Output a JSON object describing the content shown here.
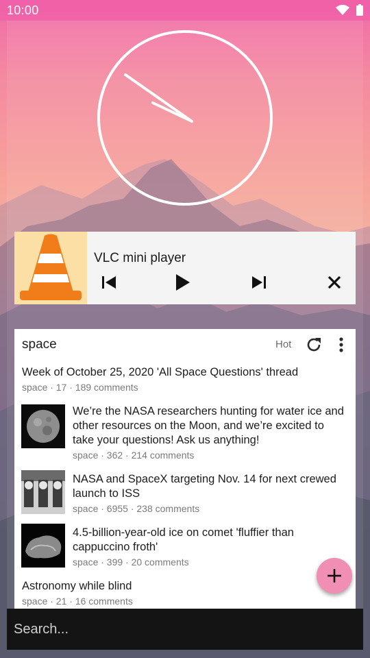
{
  "status_bar": {
    "time": "10:00",
    "icons": [
      "wifi-icon",
      "battery-icon"
    ]
  },
  "vlc_player": {
    "title": "VLC mini player",
    "controls": [
      "previous",
      "play",
      "next",
      "close"
    ]
  },
  "reddit_widget": {
    "subreddit": "space",
    "sort": "Hot",
    "posts": [
      {
        "title": "Week of October 25, 2020 'All Space Questions' thread",
        "meta": "space · 17 · 189 comments",
        "thumbnail": ""
      },
      {
        "title": "We’re the NASA researchers hunting for water ice and other resources on the Moon, and we’re excited to take your questions! Ask us anything!",
        "meta": "space · 362 · 214 comments",
        "thumbnail": "moon"
      },
      {
        "title": "NASA and SpaceX targeting Nov. 14 for next crewed launch to ISS",
        "meta": "space · 6955 · 238 comments",
        "thumbnail": "astronauts"
      },
      {
        "title": "4.5-billion-year-old ice on comet 'fluffier than cappuccino froth'",
        "meta": "space · 399 · 20 comments",
        "thumbnail": "comet"
      },
      {
        "title": "Astronomy while blind",
        "meta": "space · 21 · 16 comments",
        "thumbnail": ""
      }
    ]
  },
  "fab": {
    "icon": "plus-icon"
  },
  "search": {
    "placeholder": "Search..."
  },
  "colors": {
    "accent": "#f08fb3",
    "status_tint": "#f05aaa",
    "vlc_orange": "#f07d1a"
  }
}
